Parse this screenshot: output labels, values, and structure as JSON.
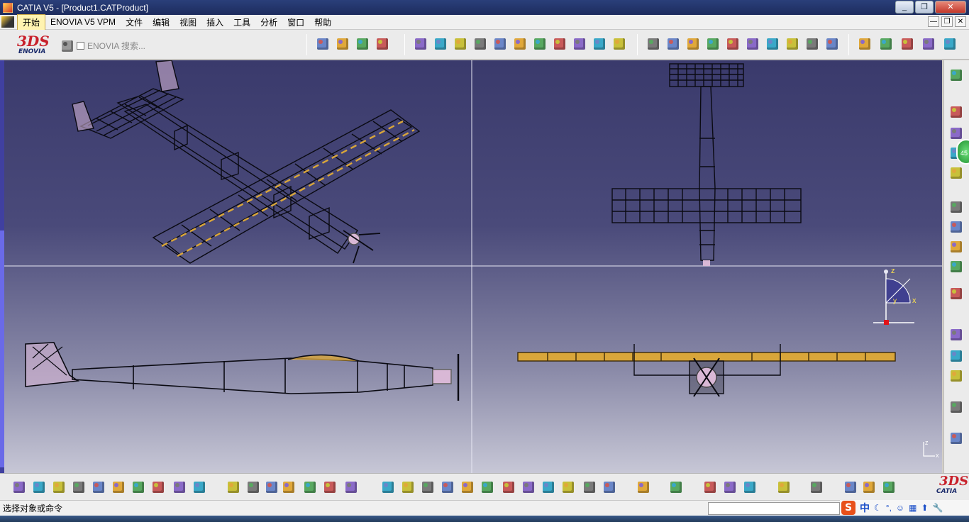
{
  "window": {
    "title": "CATIA V5 - [Product1.CATProduct]",
    "controls": {
      "minimize": "_",
      "maximize": "❐",
      "close": "✕"
    }
  },
  "menubar": {
    "items": [
      "开始",
      "ENOVIA V5 VPM",
      "文件",
      "编辑",
      "视图",
      "插入",
      "工具",
      "分析",
      "窗口",
      "帮助"
    ],
    "doc_controls": {
      "minimize": "—",
      "restore": "❐",
      "close": "✕"
    }
  },
  "toolbar_top": {
    "logo_word": "ENOVIA",
    "logo_mark": "3DS",
    "enovia_search_label": "ENOVIA 搜索...",
    "icons": [
      "update-icon",
      "gear-icon",
      "product-icon",
      "measure-icon",
      "component-icon",
      "scene-icon",
      "assembly-icon",
      "constraint-icon",
      "manipulate-icon",
      "snap-icon",
      "explode-icon",
      "clash-icon",
      "catalog-icon",
      "bom-icon",
      "publish-icon",
      "mask-icon",
      "drawing-icon",
      "space-icon",
      "compass-icon",
      "sketch-icon",
      "rotate-icon",
      "pin-icon",
      "pencil-icon",
      "clipboard-icon",
      "link-icon",
      "sync-icon",
      "pattern-icon",
      "scale-icon",
      "abc-icon",
      "annotation-icon",
      "flag-icon",
      "paint-icon"
    ]
  },
  "viewport": {
    "colors": {
      "wire": "#0a0a12",
      "balsa": "#d9a63a",
      "pink": "#d9b8d6",
      "grid_line": "#e8e8f4"
    },
    "compass_labels": {
      "x": "x",
      "y": "y",
      "z": "z"
    }
  },
  "toolbar_right": {
    "icons": [
      "assembly-tree-icon",
      "insert-part-icon",
      "new-component-icon",
      "copy-icon",
      "existing-icon",
      "replace-icon",
      "reorder-icon",
      "number-icon",
      "multi-icon",
      "pointer-icon",
      "explode-icon",
      "move-icon",
      "fix-icon",
      "select-icon",
      "constraint-icon"
    ],
    "badge": "45"
  },
  "toolbar_bottom": {
    "icons": [
      "new-icon",
      "open-icon",
      "save-icon",
      "print-icon",
      "cut-icon",
      "copy-icon",
      "paste-icon",
      "undo-icon",
      "redo-icon",
      "whats-this-icon",
      "formula-icon",
      "comment-icon",
      "measure-icon",
      "table-icon",
      "tree-icon",
      "lock-icon",
      "split-icon",
      "fly-icon",
      "fit-all-icon",
      "pan-icon",
      "rotate-icon",
      "zoom-in-icon",
      "zoom-out-icon",
      "normal-view-icon",
      "iso-view-icon",
      "cube-view-icon",
      "cylinder-view-icon",
      "shading-icon",
      "render-icon",
      "camera-icon",
      "capture-icon",
      "ruler-icon",
      "swap-icon",
      "bottle-icon",
      "refresh-icon",
      "eraser-icon",
      "analyze-icon",
      "material-icon",
      "palette-icon"
    ],
    "logo_word": "CATIA",
    "logo_mark": "3DS"
  },
  "statusbar": {
    "text": "选择对象或命令",
    "ime": {
      "brand": "S",
      "mode": "中",
      "items": [
        "☾",
        "°,",
        "☺",
        "▦",
        "⬆",
        "🔧"
      ]
    }
  }
}
